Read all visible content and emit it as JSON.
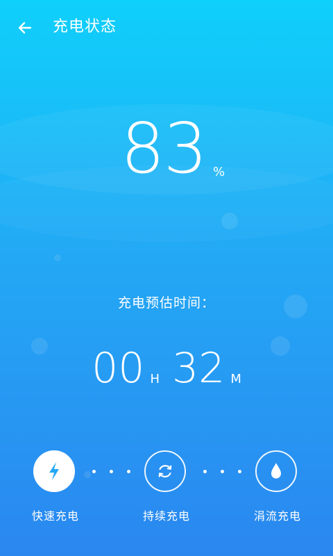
{
  "header": {
    "back_icon": "arrow-left-icon",
    "title": "充电状态"
  },
  "battery": {
    "level": "83",
    "unit": "%"
  },
  "estimate": {
    "label": "充电预估时间：",
    "hours": "00",
    "hours_unit": "H",
    "minutes": "32",
    "minutes_unit": "M"
  },
  "charge_modes": [
    {
      "label": "快速充电",
      "icon": "lightning-bolt-icon",
      "active": true
    },
    {
      "label": "持续充电",
      "icon": "refresh-cycle-icon",
      "active": false
    },
    {
      "label": "涓流充电",
      "icon": "water-drop-icon",
      "active": false
    }
  ],
  "colors": {
    "gradient_top": "#0fd0fb",
    "gradient_middle": "#23a9f5",
    "gradient_bottom": "#2a87f0",
    "text": "#ffffff",
    "active_icon": "#24a8f5"
  }
}
